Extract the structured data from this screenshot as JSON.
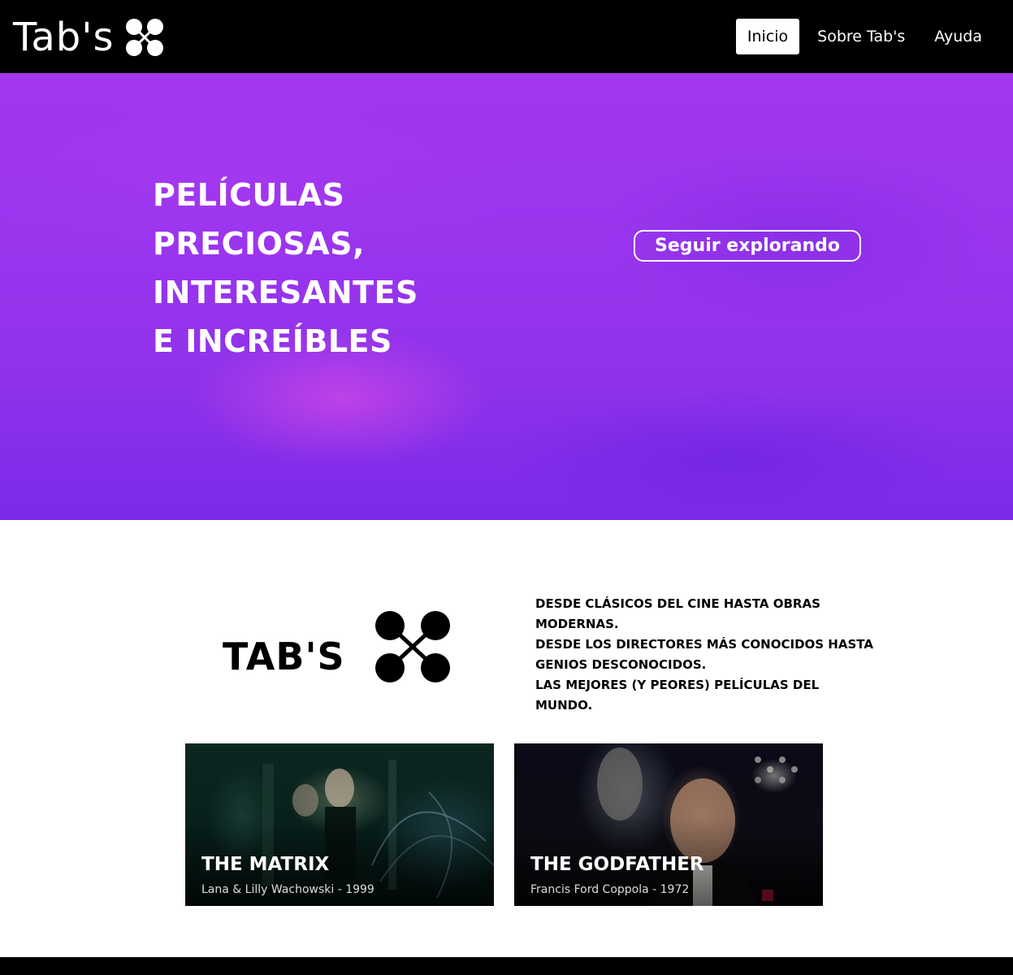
{
  "header": {
    "brand": "Tab's",
    "nav": [
      {
        "label": "Inicio",
        "active": true
      },
      {
        "label": "Sobre Tab's",
        "active": false
      },
      {
        "label": "Ayuda",
        "active": false
      }
    ]
  },
  "hero": {
    "title_lines": [
      "PELÍCULAS",
      "PRECIOSAS,",
      "INTERESANTES",
      "E INCREÍBLES"
    ],
    "cta_label": "Seguir explorando"
  },
  "about": {
    "title": "TAB'S",
    "lines": [
      "DESDE CLÁSICOS DEL CINE HASTA OBRAS",
      "MODERNAS.",
      "DESDE LOS DIRECTORES MÁS CONOCIDOS HASTA",
      "GENIOS DESCONOCIDOS.",
      "LAS MEJORES (Y PEORES) PELÍCULAS DEL MUNDO."
    ]
  },
  "movies": [
    {
      "title": "THE MATRIX",
      "subtitle": "Lana & Lilly Wachowski - 1999"
    },
    {
      "title": "THE GODFATHER",
      "subtitle": "Francis Ford Coppola - 1972"
    }
  ],
  "colors": {
    "header_bg": "#000000",
    "hero_purple": "#9a35ee",
    "accent_white": "#ffffff"
  }
}
